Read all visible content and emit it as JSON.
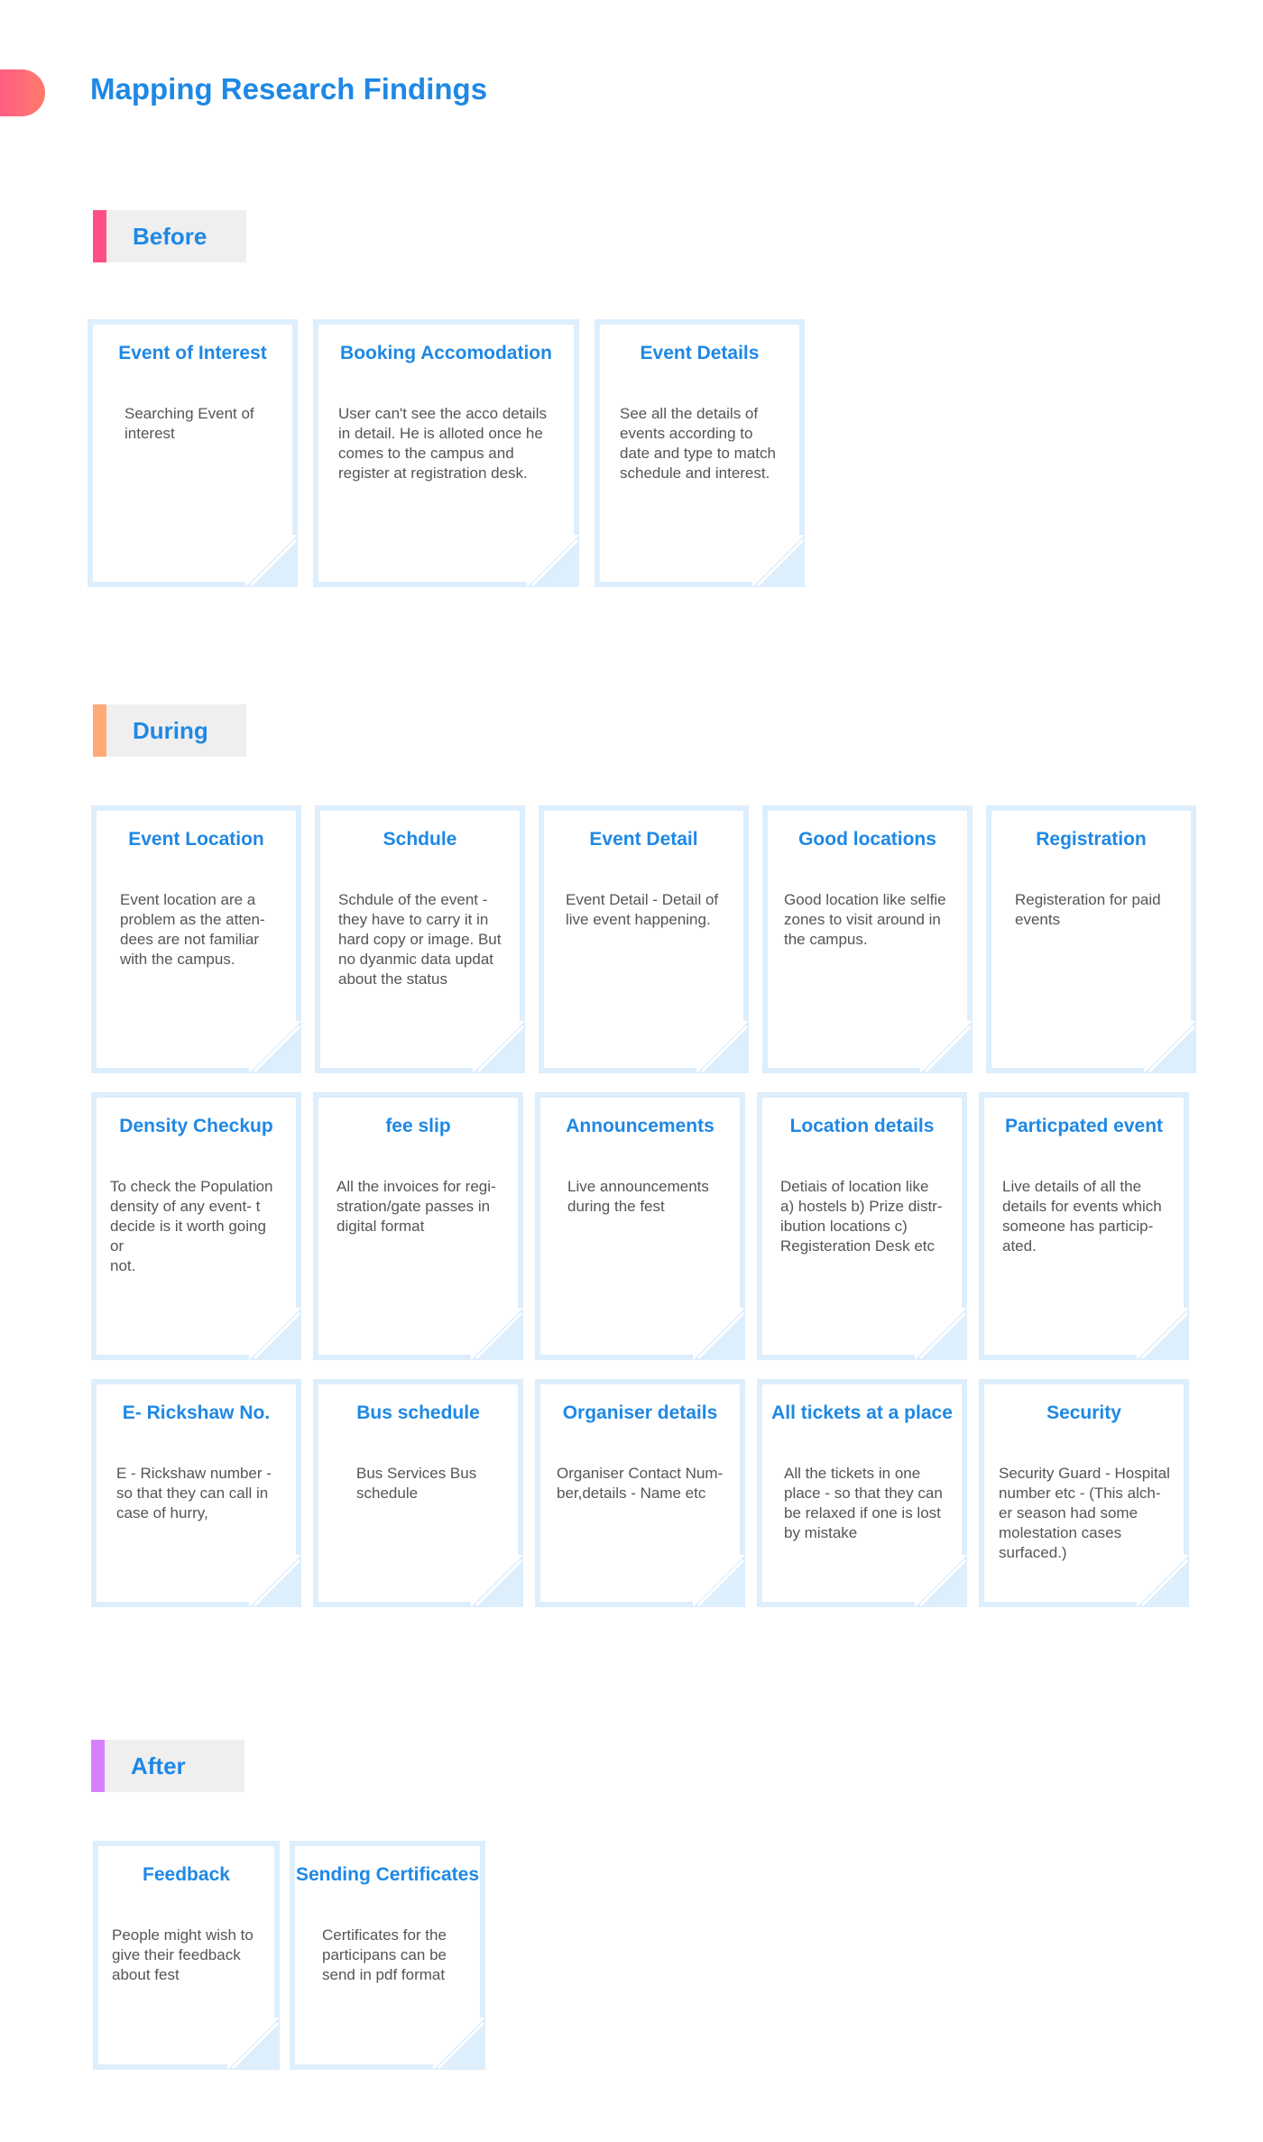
{
  "page": {
    "title": "Mapping Research Findings",
    "accent": "#ff5f84"
  },
  "sections": {
    "before": {
      "label": "Before",
      "bar_color": "#ff4f86"
    },
    "during": {
      "label": "During",
      "bar_color": "#ffab78"
    },
    "after": {
      "label": "After",
      "bar_color": "#d680fb"
    }
  },
  "cards": {
    "before": [
      {
        "title": "Event of Interest",
        "body": "Searching Event of\ninterest"
      },
      {
        "title": "Booking Accomodation",
        "body": "User can't see the acco details\nin detail. He is alloted once he\ncomes to the campus and\nregister at registration desk."
      },
      {
        "title": "Event Details",
        "body": "See all the details of\nevents according to\ndate and type to match\nschedule and interest."
      }
    ],
    "during": [
      {
        "title": "Event Location",
        "body": "Event location are a\nproblem as the atten-\ndees are not familiar\nwith the campus."
      },
      {
        "title": "Schdule",
        "body": "Schdule of the event -\nthey have to carry it in\nhard copy or image. But\nno dyanmic data updat\n about the status"
      },
      {
        "title": "Event Detail",
        "body": "Event Detail - Detail of\nlive event happening."
      },
      {
        "title": "Good locations",
        "body": "Good location like selfie\nzones to visit around in\nthe campus."
      },
      {
        "title": "Registration",
        "body": "Registeration for paid\nevents"
      },
      {
        "title": "Density Checkup",
        "body": "To check the Population\ndensity of any event- t\ndecide is it worth going\nor\nnot."
      },
      {
        "title": "fee slip",
        "body": "All the invoices for regi-\nstration/gate passes in\ndigital format"
      },
      {
        "title": "Announcements",
        "body": "Live announcements\nduring the fest"
      },
      {
        "title": "Location details",
        "body": "Detiais of location like\na) hostels b) Prize distr-\nibution locations c)\nRegisteration Desk etc"
      },
      {
        "title": "Particpated event",
        "body": "Live details of all the\ndetails for events which\nsomeone has particip-\nated."
      },
      {
        "title": "E- Rickshaw No.",
        "body": "E - Rickshaw number -\nso that they can call in\ncase of hurry,"
      },
      {
        "title": "Bus schedule",
        "body": "Bus Services Bus\nschedule"
      },
      {
        "title": "Organiser details",
        "body": "Organiser Contact Num-\nber,details - Name etc"
      },
      {
        "title": "All tickets at a place",
        "body": "All the tickets in one\nplace - so that they can\nbe relaxed if one is lost\nby mistake"
      },
      {
        "title": "Security",
        "body": "Security Guard - Hospital\nnumber etc - (This alch-\ner season had some\nmolestation cases\nsurfaced.)"
      }
    ],
    "after": [
      {
        "title": "Feedback",
        "body": "People might wish to\ngive their feedback\nabout fest"
      },
      {
        "title": "Sending Certificates",
        "body": "Certificates for the\nparticipans can be\nsend in pdf format"
      }
    ]
  },
  "colors": {
    "card_border": "#ddeefd",
    "title_blue": "#1e88e5",
    "body_text": "#555555"
  }
}
